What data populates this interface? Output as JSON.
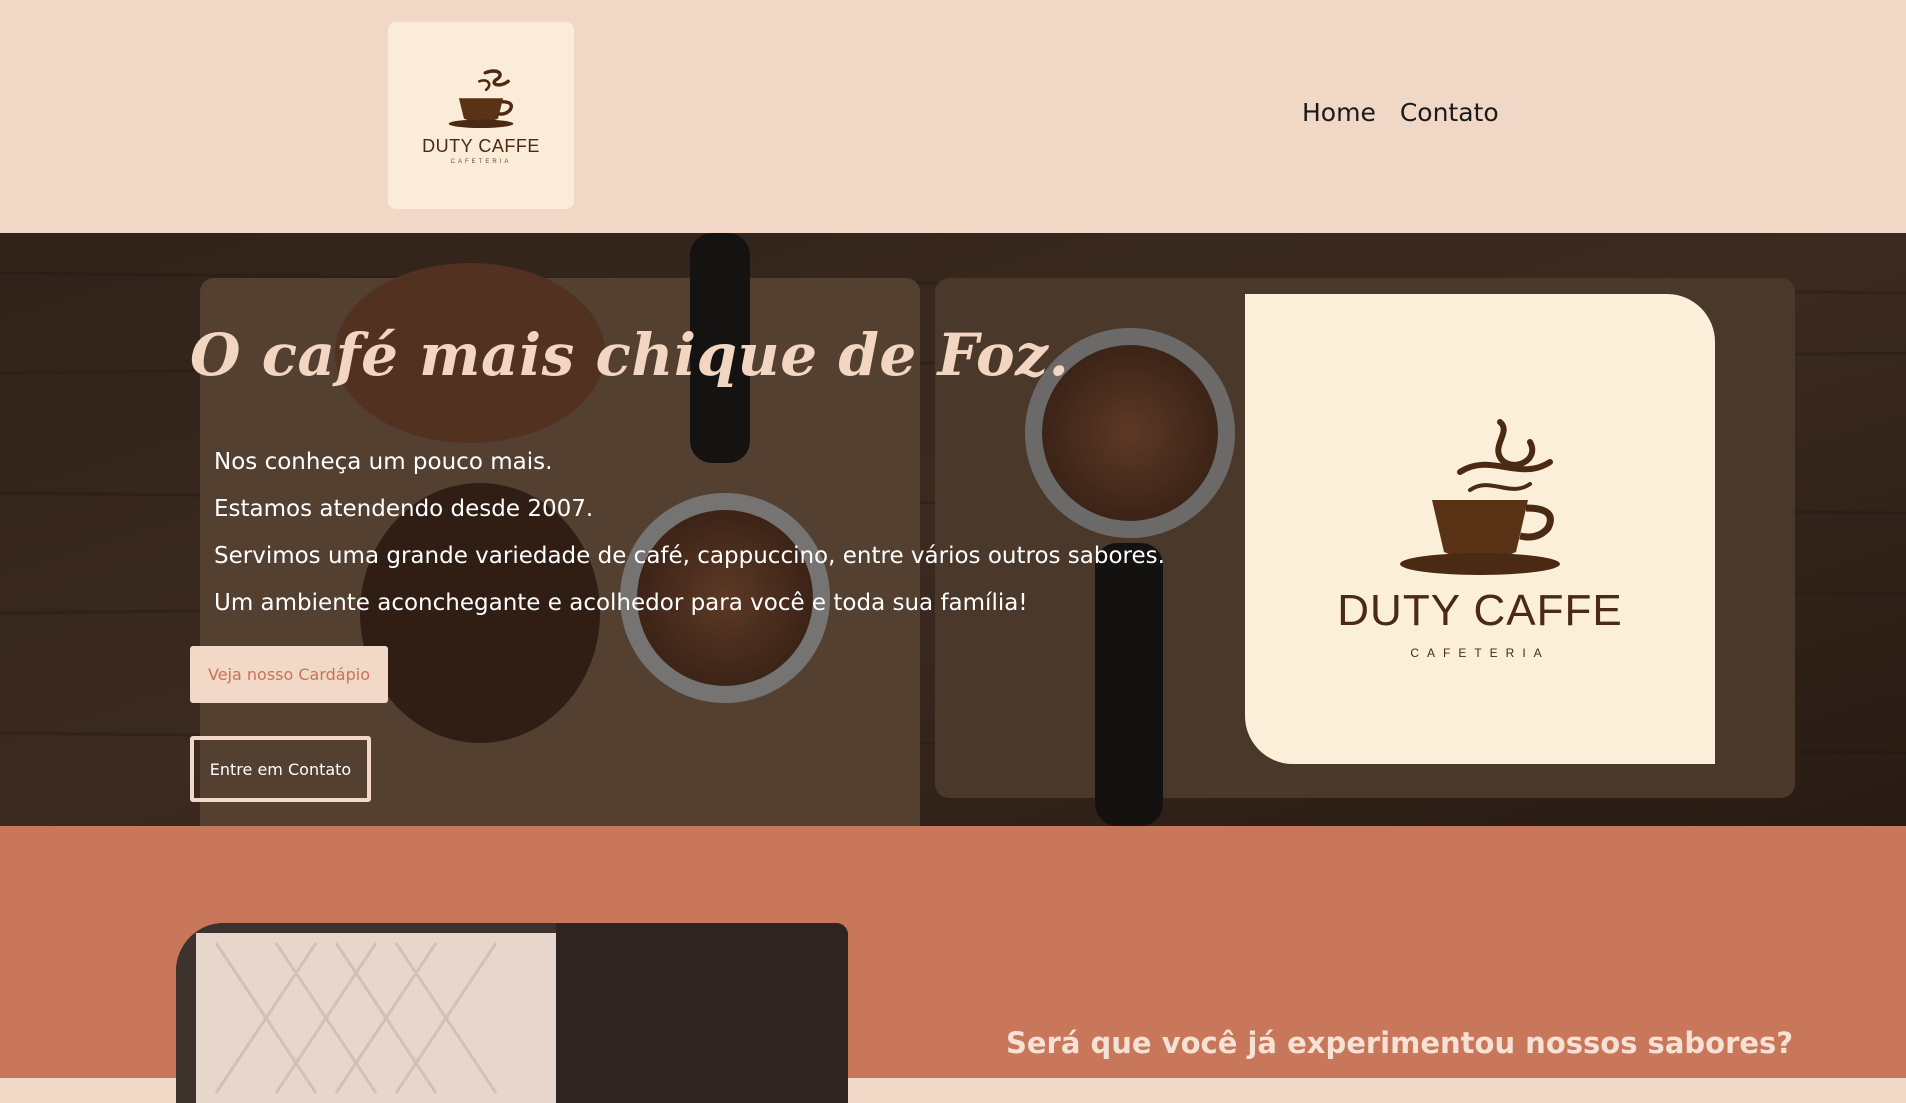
{
  "header": {
    "logo": {
      "name": "DUTY CAFFE",
      "subtitle": "CAFETERIA"
    },
    "nav": [
      {
        "label": "Home"
      },
      {
        "label": "Contato"
      }
    ]
  },
  "hero": {
    "title": "O café mais chique de Foz.",
    "paragraphs": [
      "Nos conheça um pouco mais.",
      "Estamos atendendo desde 2007.",
      "Servimos uma grande variedade de café, cappuccino, entre vários outros sabores.",
      "Um ambiente aconchegante e acolhedor para você e toda sua família!"
    ],
    "primary_button": "Veja nosso Cardápio",
    "secondary_button": "Entre em Contato",
    "logo": {
      "name": "DUTY CAFFE",
      "subtitle": "CAFETERIA"
    }
  },
  "section2": {
    "heading": "Será que você já experimentou nossos sabores?"
  },
  "colors": {
    "header_bg": "#f0d7c6",
    "logo_card_bg": "#fbefd9",
    "accent_terracotta": "#c8775b",
    "brand_brown": "#4a2a12"
  }
}
